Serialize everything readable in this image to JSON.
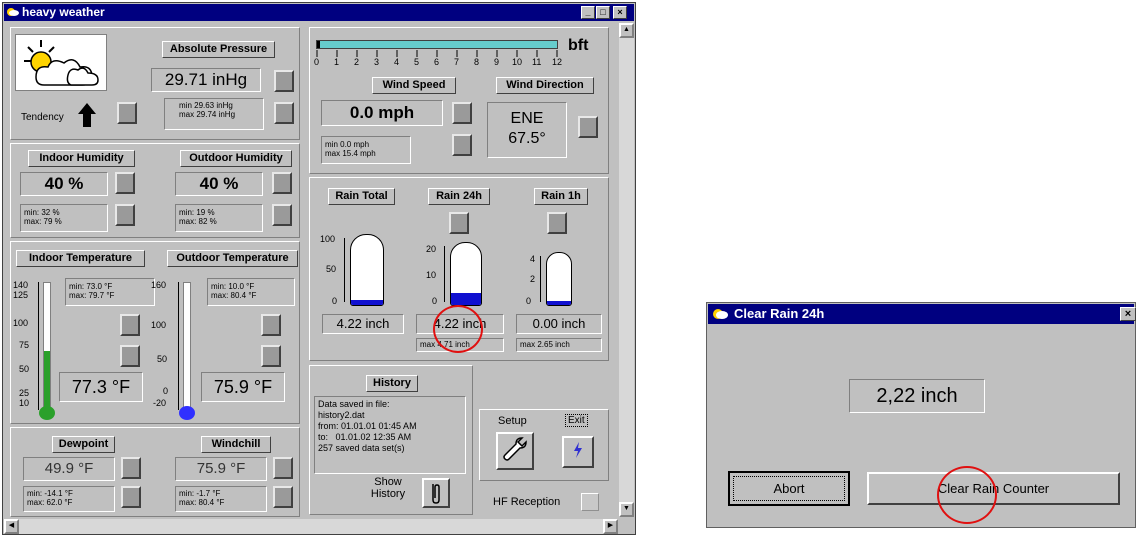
{
  "main_window": {
    "title": "heavy weather",
    "controls": {
      "minimize": "_",
      "maximize": "□",
      "close": "×"
    }
  },
  "pressure": {
    "label": "Absolute Pressure",
    "value": "29.71 inHg",
    "min": "min 29.63 inHg",
    "max": "max 29.74 inHg",
    "tendency_label": "Tendency"
  },
  "humidity": {
    "indoor_label": "Indoor Humidity",
    "indoor_value": "40 %",
    "indoor_min": "min: 32 %",
    "indoor_max": "max: 79 %",
    "outdoor_label": "Outdoor Humidity",
    "outdoor_value": "40 %",
    "outdoor_min": "min: 19 %",
    "outdoor_max": "max: 82 %"
  },
  "temperature": {
    "indoor_label": "Indoor Temperature",
    "indoor_value": "77.3 °F",
    "indoor_min": "min: 73.0 °F",
    "indoor_max": "max: 79.7 °F",
    "indoor_ticks": [
      "140",
      "125",
      "100",
      "75",
      "50",
      "25",
      "10"
    ],
    "indoor_level": 0.47,
    "outdoor_label": "Outdoor Temperature",
    "outdoor_value": "75.9 °F",
    "outdoor_min": "min: 10.0 °F",
    "outdoor_max": "max: 80.4 °F",
    "outdoor_ticks": [
      "160",
      "100",
      "50",
      "0",
      "-20"
    ],
    "outdoor_level": 0.0
  },
  "dewpoint": {
    "label": "Dewpoint",
    "value": "49.9 °F",
    "min": "min: -14.1 °F",
    "max": "max: 62.0 °F"
  },
  "windchill": {
    "label": "Windchill",
    "value": "75.9 °F",
    "min": "min: -1.7 °F",
    "max": "max: 80.4 °F"
  },
  "wind": {
    "bft_label": "bft",
    "bft_ticks": [
      "0",
      "1",
      "2",
      "3",
      "4",
      "5",
      "6",
      "7",
      "8",
      "9",
      "10",
      "11",
      "12"
    ],
    "speed_label": "Wind Speed",
    "speed_value": "0.0 mph",
    "speed_min": "min 0.0 mph",
    "speed_max": "max 15.4 mph",
    "direction_label": "Wind Direction",
    "direction_value": "ENE",
    "direction_degrees": "67.5°"
  },
  "rain": {
    "total_label": "Rain Total",
    "total_value": "4.22 inch",
    "total_ticks": [
      "100",
      "50",
      "0"
    ],
    "r24_label": "Rain 24h",
    "r24_value": "4.22 inch",
    "r24_max": "max 4.71 inch",
    "r24_ticks": [
      "20",
      "10",
      "0"
    ],
    "r1_label": "Rain 1h",
    "r1_value": "0.00 inch",
    "r1_max": "max 2.65 inch",
    "r1_ticks": [
      "4",
      "2",
      "0"
    ]
  },
  "history": {
    "label": "History",
    "line1": "Data saved in file:",
    "line2": "history2.dat",
    "line3": "from: 01.01.01 01:45 AM",
    "line4": "to:   01.01.02 12:35 AM",
    "line5": "257 saved data set(s)",
    "show_label_1": "Show",
    "show_label_2": "History"
  },
  "controls": {
    "setup_label": "Setup",
    "exit_label": "Exit",
    "hf_label": "HF Reception"
  },
  "dialog": {
    "title": "Clear Rain 24h",
    "close": "×",
    "value": "2,22 inch",
    "abort_label": "Abort",
    "clear_label": "Clear Rain Counter"
  },
  "colors": {
    "titlebar": "#000080",
    "panel": "#c0c0c0",
    "thermo_indoor": "#2aa02a",
    "thermo_outdoor": "#3030ff",
    "rain_fill": "#1010d0",
    "bft_bar": "#66cccc",
    "highlight_circle": "#e01010"
  }
}
